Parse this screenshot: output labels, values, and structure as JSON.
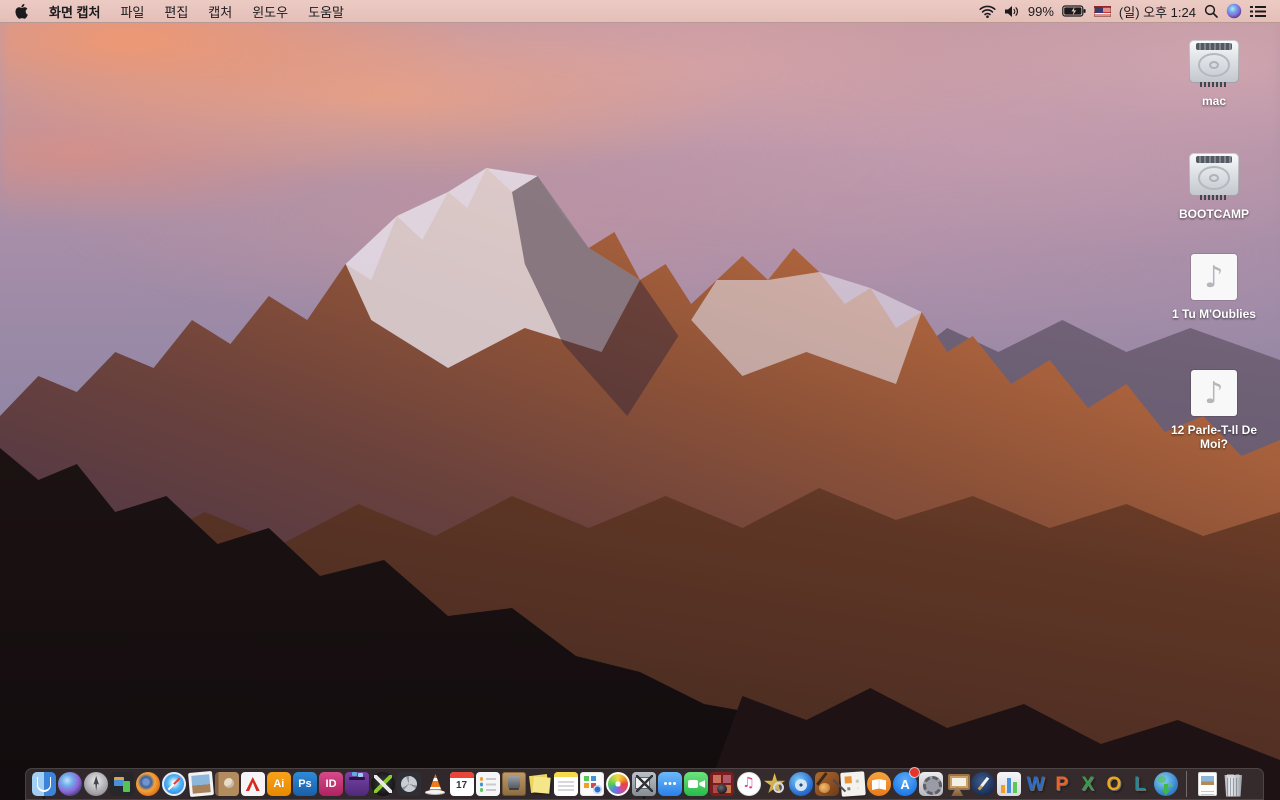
{
  "menu_bar": {
    "app_name": "화면 캡처",
    "menus": [
      "파일",
      "편집",
      "캡처",
      "윈도우",
      "도움말"
    ],
    "battery_percent": "99%",
    "clock": "(일) 오후 1:24",
    "status_icons": [
      "wifi-icon",
      "volume-icon",
      "battery-charging-icon",
      "us-flag-input-source-icon",
      "spotlight-search-icon",
      "siri-icon",
      "notification-center-icon"
    ]
  },
  "desktop_icons": [
    {
      "label": "mac",
      "type": "hard-drive"
    },
    {
      "label": "BOOTCAMP",
      "type": "hard-drive"
    },
    {
      "label": "1 Tu M'Oublies",
      "type": "audio-file"
    },
    {
      "label": "12 Parle-T-Il De Moi?",
      "type": "audio-file"
    }
  ],
  "dock": {
    "apps": [
      "finder",
      "siri",
      "launchpad",
      "display-windows-app",
      "firefox",
      "safari",
      "image-viewer",
      "contacts",
      "acrobat-reader",
      "illustrator",
      "photoshop",
      "indesign",
      "toast-titanium",
      "media-converter",
      "disk-tool",
      "vlc",
      "calendar",
      "reminders",
      "letterpress-box-app",
      "stickies",
      "notes",
      "print-labels-app",
      "photos",
      "grab-screen-capture",
      "messages",
      "facetime",
      "photo-booth",
      "itunes",
      "star-finder-app",
      "dvd-tool",
      "garageband",
      "page-layout-app",
      "ibooks",
      "app-store",
      "system-preferences",
      "keynote",
      "pages",
      "numbers",
      "word",
      "powerpoint",
      "excel",
      "outlook",
      "lync",
      "web-downloader",
      "document-file",
      "trash"
    ],
    "running_apps": [
      "finder",
      "grab-screen-capture"
    ],
    "glyphs": {
      "illustrator": "Ai",
      "photoshop": "Ps",
      "indesign": "ID",
      "calendar_day": "17",
      "appstore": "A",
      "word": "W",
      "powerpoint": "P",
      "excel": "X",
      "outlook": "O",
      "lync": "L"
    }
  },
  "colors": {
    "menubar_bg": "#e9c6bf",
    "dock_bg": "rgba(72,64,66,0.55)",
    "sunlit_rock": "#d98148",
    "sky_pink": "#c59aa4"
  }
}
